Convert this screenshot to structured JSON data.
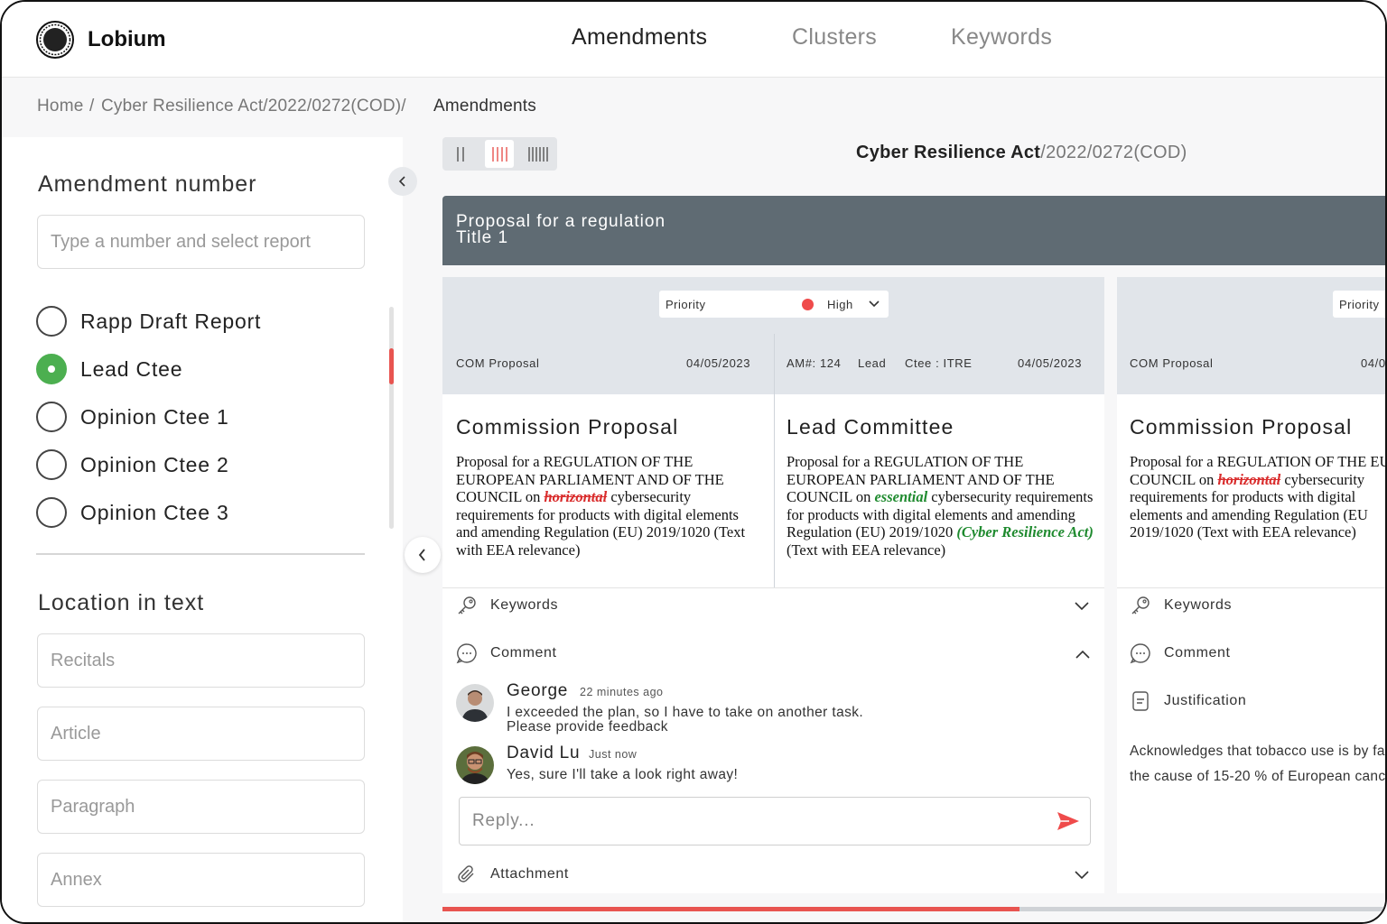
{
  "app": {
    "name": "Lobium"
  },
  "nav": {
    "tabs": [
      "Amendments",
      "Clusters",
      "Keywords"
    ],
    "active": "Amendments"
  },
  "breadcrumb": {
    "home": "Home",
    "sep1": "/",
    "procedure": "Cyber Resilience Act/2022/0272(COD)/",
    "current": "Amendments"
  },
  "sidebar": {
    "amendment_title": "Amendment number",
    "amendment_placeholder": "Type a number and select report",
    "reports": [
      {
        "label": "Rapp Draft Report",
        "selected": false
      },
      {
        "label": "Lead Ctee",
        "selected": true
      },
      {
        "label": "Opinion Ctee 1",
        "selected": false
      },
      {
        "label": "Opinion Ctee 2",
        "selected": false
      },
      {
        "label": "Opinion Ctee 3",
        "selected": false
      }
    ],
    "location_title": "Location in text",
    "location_fields": [
      "Recitals",
      "Article",
      "Paragraph",
      "Annex"
    ]
  },
  "document": {
    "title_bold": "Cyber Resilience Act",
    "title_rest": "/2022/0272(COD)"
  },
  "section": {
    "line1": "Proposal for a regulation",
    "line2": "Title 1"
  },
  "card1": {
    "priority_label": "Priority",
    "priority_value": "High",
    "priority_color": "#ef4b4b",
    "left": {
      "source": "COM Proposal",
      "date": "04/05/2023",
      "heading": "Commission Proposal",
      "text_a": "Proposal for a REGULATION OF THE EUROPEAN PARLIAMENT AND OF THE COUNCIL on ",
      "text_del": "horizontal",
      "text_b": " cybersecurity requirements for products with digital elements and amending Regulation (EU) 2019/1020 (Text with EEA relevance)"
    },
    "right": {
      "am_no": "AM#: 124",
      "lead": "Lead",
      "ctee": "Ctee : ITRE",
      "date": "04/05/2023",
      "heading": "Lead Committee",
      "text_a": "Proposal for a REGULATION OF THE EUROPEAN PARLIAMENT AND OF THE COUNCIL on ",
      "text_ins1": "essential",
      "text_b": " cybersecurity requirements for products with digital elements and amending Regulation (EU) 2019/1020 ",
      "text_ins2": "(Cyber Resilience Act)",
      "text_c": " (Text with EEA relevance)"
    },
    "keywords_label": "Keywords",
    "comment_label": "Comment",
    "comments": [
      {
        "name": "George",
        "time": "22 minutes ago",
        "line1": "I exceeded the plan, so I have to take on another task.",
        "line2": "Please provide feedback"
      },
      {
        "name": "David Lu",
        "time": "Just now",
        "line1": "Yes, sure I'll take a look right away!",
        "line2": ""
      }
    ],
    "reply_placeholder": "Reply...",
    "attachment_label": "Attachment"
  },
  "card2": {
    "priority_label": "Priority",
    "source": "COM Proposal",
    "date_partial": "04/0",
    "heading": "Commission Proposal",
    "text_a": "Proposal for a REGULATION OF THE EUROPEAN PARLIAMENT AND OF T",
    "text_full_a": "Proposal for a REGULATION OF THE EUROPEAN PARLIAMENT AND OF THE COUNCIL on ",
    "text_del": "horizontal",
    "text_b": " cybersecurity requirements for products with digital elements and amending Regulation (EU 2019/1020 (Text with EEA relevance)",
    "keywords_label": "Keywords",
    "comment_label": "Comment",
    "justification_label": "Justification",
    "justification_line1": "Acknowledges that tobacco use is by fa",
    "justification_line2": "the cause of 15-20 % of European canc"
  },
  "progress": {
    "value": 0.61,
    "color": "#e85450"
  },
  "colors": {
    "accent": "#e85450",
    "selected": "#4caf50",
    "banner": "#5f6b73",
    "header_band": "#e1e5ea"
  }
}
